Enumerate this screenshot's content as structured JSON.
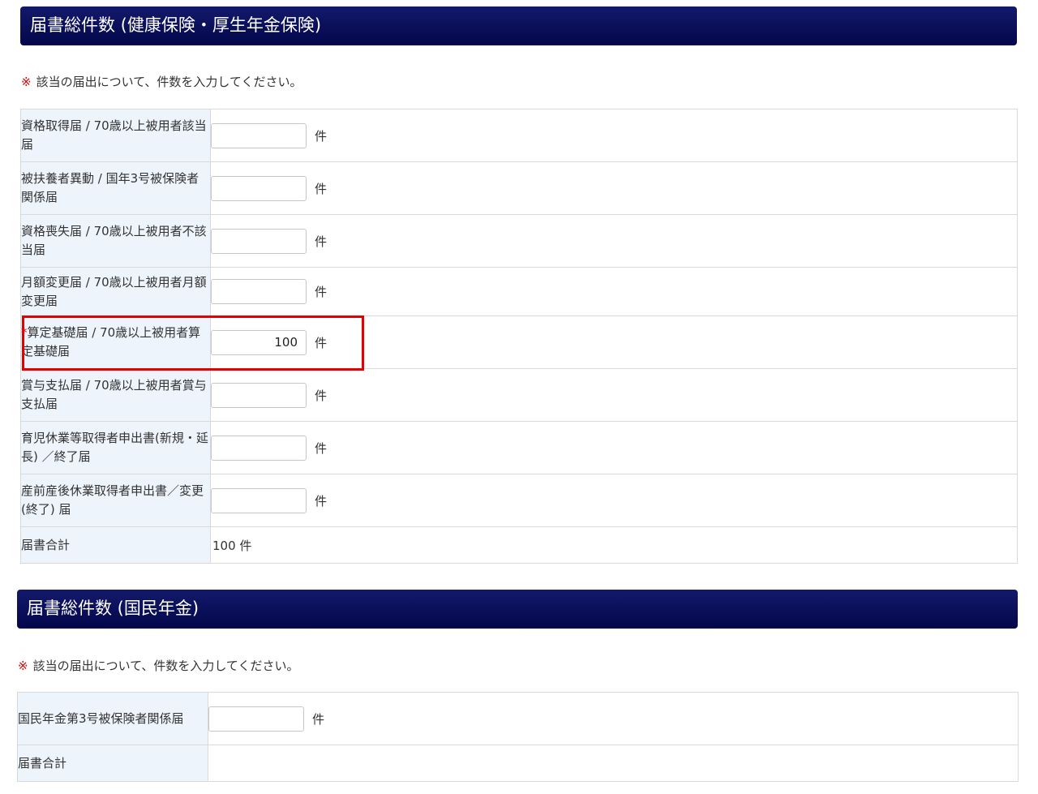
{
  "section1": {
    "title": "届書総件数 (健康保険・厚生年金保険)",
    "note_mark": "※",
    "note_text": "該当の届出について、件数を入力してください。",
    "rows": [
      {
        "label": "資格取得届 / 70歳以上被用者該当届",
        "value": "",
        "unit": "件"
      },
      {
        "label": "被扶養者異動 / 国年3号被保険者関係届",
        "value": "",
        "unit": "件"
      },
      {
        "label": "資格喪失届 / 70歳以上被用者不該当届",
        "value": "",
        "unit": "件"
      },
      {
        "label": "月額変更届 / 70歳以上被用者月額変更届",
        "value": "",
        "unit": "件"
      },
      {
        "required_mark": "*",
        "label": "算定基礎届 / 70歳以上被用者算定基礎届",
        "value": "100",
        "unit": "件"
      },
      {
        "label": "賞与支払届 / 70歳以上被用者賞与支払届",
        "value": "",
        "unit": "件"
      },
      {
        "label": "育児休業等取得者申出書(新規・延長) ／終了届",
        "value": "",
        "unit": "件"
      },
      {
        "label": "産前産後休業取得者申出書／変更 (終了) 届",
        "value": "",
        "unit": "件"
      }
    ],
    "total_label": "届書合計",
    "total_value": "100 件"
  },
  "section2": {
    "title": "届書総件数 (国民年金)",
    "note_mark": "※",
    "note_text": "該当の届出について、件数を入力してください。",
    "rows": [
      {
        "label": "国民年金第3号被保険者関係届",
        "value": "",
        "unit": "件"
      }
    ],
    "total_label": "届書合計",
    "total_value": ""
  },
  "colors": {
    "header_bg": "#0a0f5c",
    "label_bg": "#edf4fc",
    "required": "#e60000",
    "highlight_border": "#e60000"
  }
}
